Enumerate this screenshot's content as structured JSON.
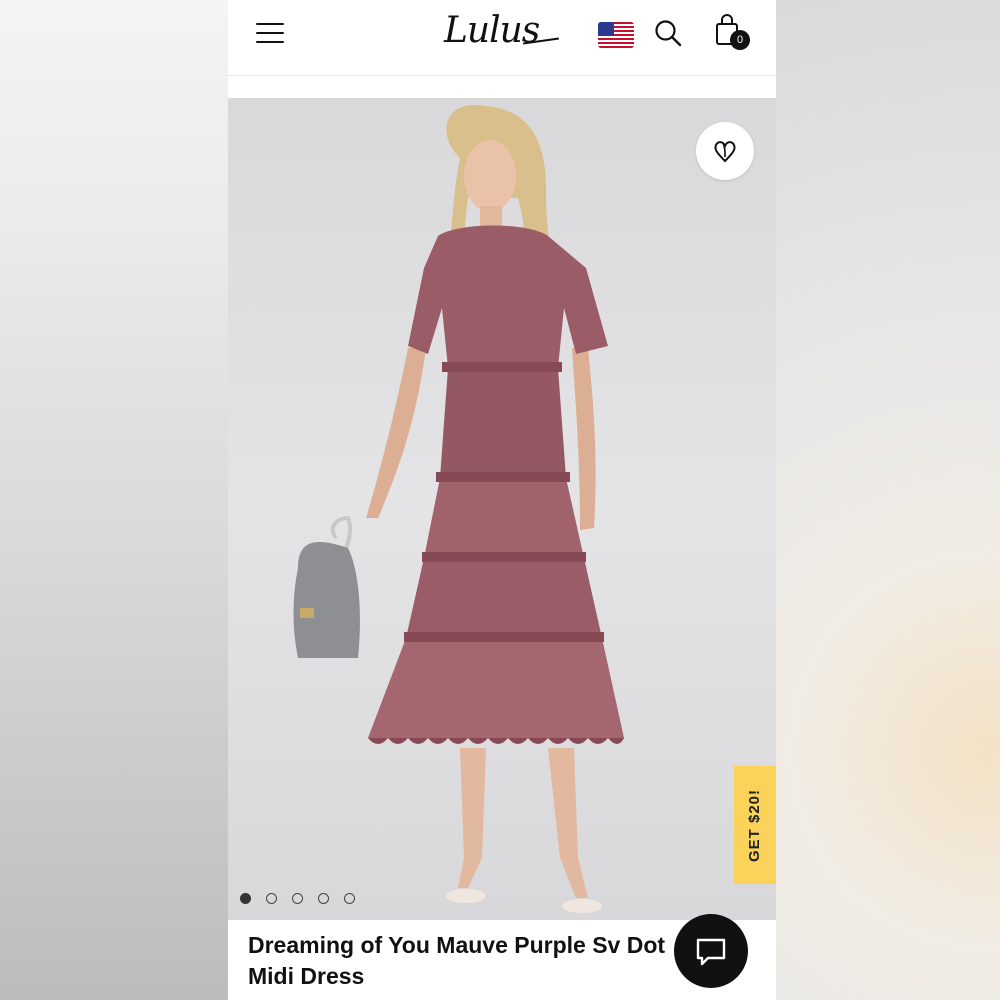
{
  "header": {
    "brand": "Lulus",
    "cart_count": "0",
    "menu_icon": "hamburger-menu-icon",
    "search_icon": "search-icon",
    "bag_icon": "shopping-bag-icon",
    "flag_icon": "us-flag-icon"
  },
  "hero": {
    "image_label": "product-photo",
    "favorite_icon": "heart-icon",
    "carousel": {
      "total": 5,
      "active_index": 0
    },
    "promo_tab_label": "GET $20!"
  },
  "product": {
    "title": "Dreaming of You Mauve Purple Sv Dot Midi Dress"
  },
  "chat": {
    "icon": "chat-bubble-icon"
  },
  "colors": {
    "dress": "#9a5c66",
    "promo": "#fbd25a",
    "background": "#e0e0e2"
  }
}
